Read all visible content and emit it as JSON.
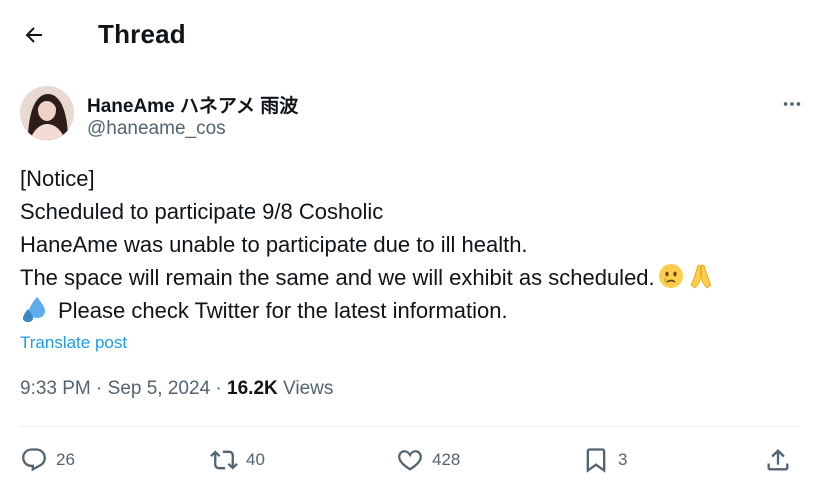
{
  "header": {
    "title": "Thread",
    "back_icon": "arrow-left-icon"
  },
  "author": {
    "display_name": "HaneAme ハネアメ 雨波",
    "handle": "@haneame_cos",
    "more_icon": "more-horizontal-icon"
  },
  "post": {
    "lines": [
      "[Notice]",
      "Scheduled to participate 9/8 Cosholic",
      "HaneAme was unable to participate due to ill health.",
      "The space will remain the same and we will exhibit as scheduled.",
      "Please check Twitter for the latest information."
    ],
    "emojis": [
      "face-holding-back-tears-icon",
      "folded-hands-icon",
      "sweat-droplets-icon"
    ],
    "translate_label": "Translate post"
  },
  "meta": {
    "time": "9:33 PM",
    "separator": " · ",
    "date": "Sep 5, 2024",
    "views_count": "16.2K",
    "views_label": "Views"
  },
  "actions": {
    "replies": "26",
    "reposts": "40",
    "likes": "428",
    "bookmarks": "3"
  },
  "colors": {
    "text": "#0f1419",
    "secondary": "#536471",
    "link": "#1d9bf0",
    "divider": "#eff3f4"
  }
}
